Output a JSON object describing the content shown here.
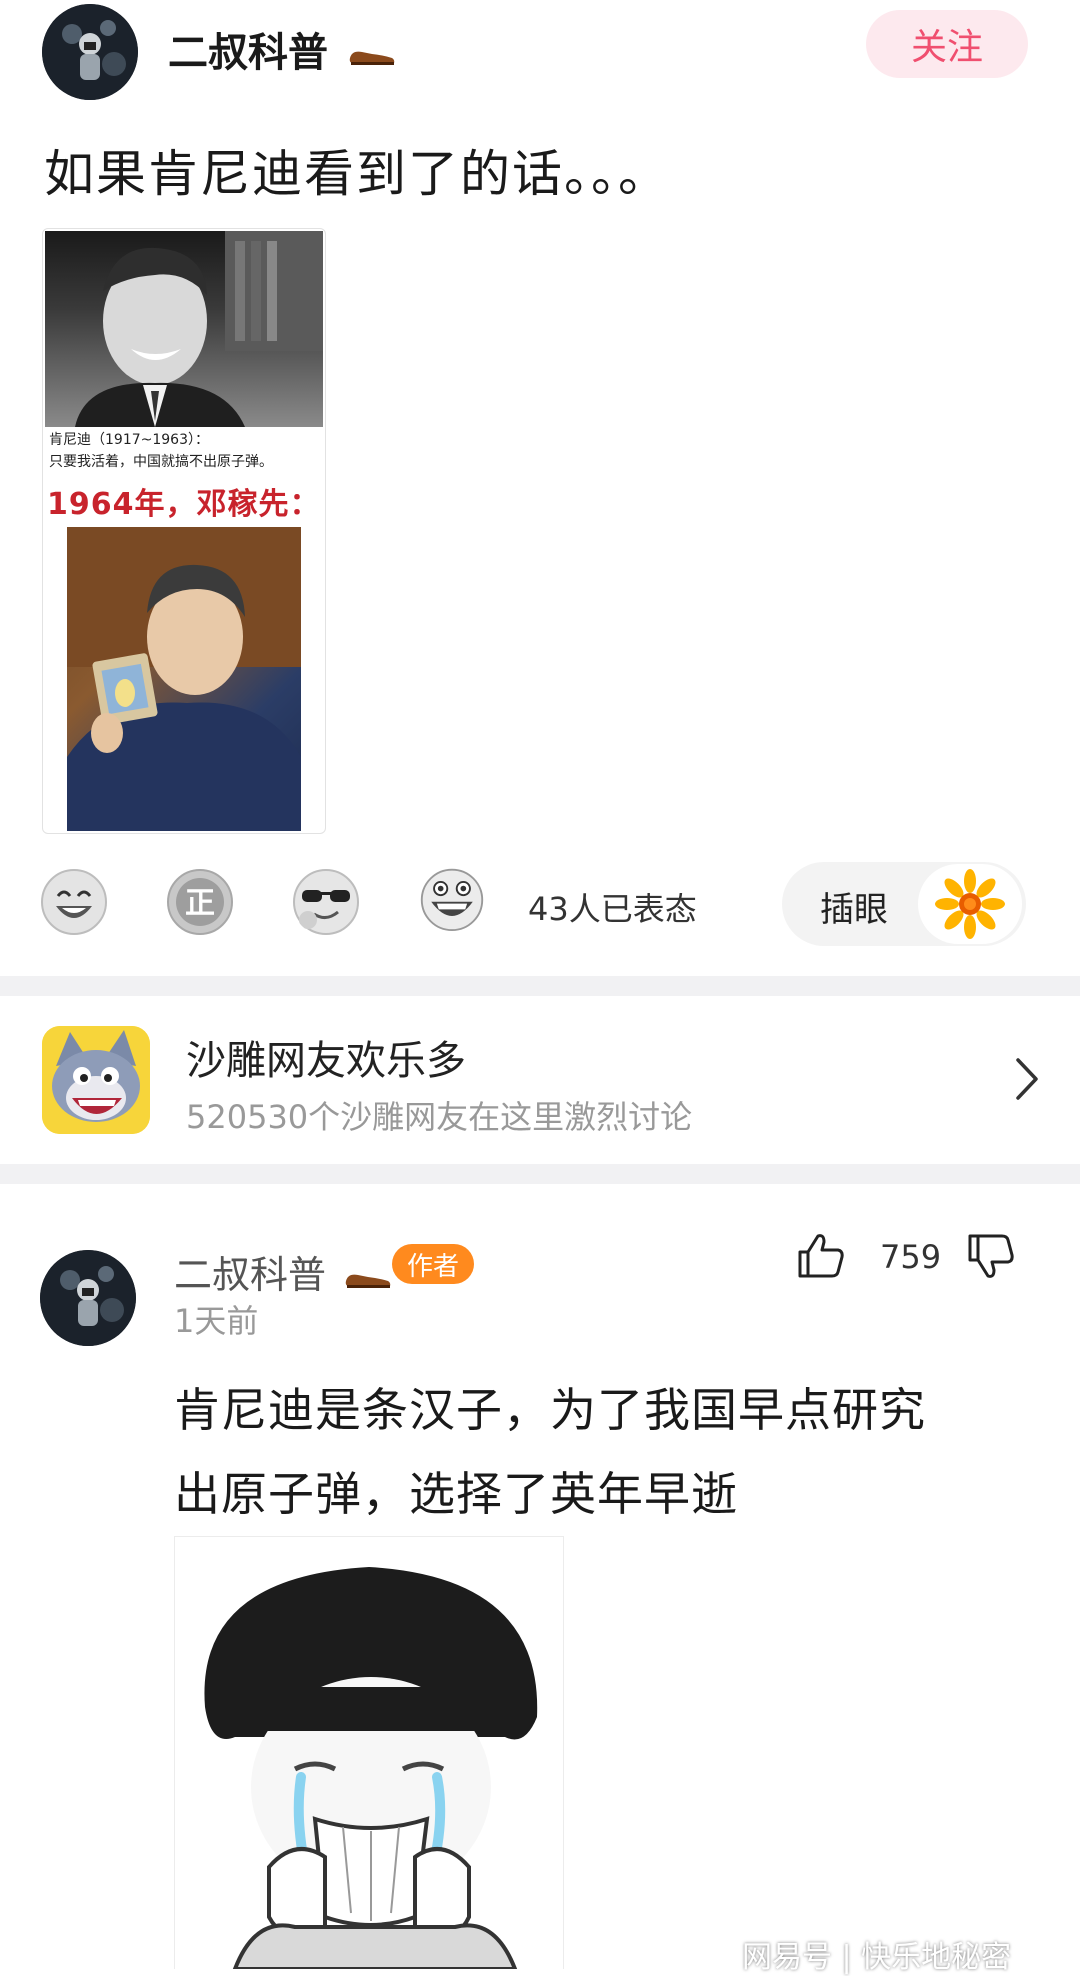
{
  "post": {
    "author": "二叔科普",
    "author_badge_icon": "shoe-icon",
    "follow_label": "关注",
    "title": "如果肯尼迪看到了的话。。。",
    "image": {
      "caption_line1": "肯尼迪（1917~1963）：",
      "caption_line2": "只要我活着，中国就搞不出原子弹。",
      "headline": "1964年，邓稼先："
    }
  },
  "reactions": {
    "icons": [
      "laughing-face-icon",
      "zheng-badge-icon",
      "sunglasses-face-icon",
      "grinning-face-icon"
    ],
    "count_label": "43人已表态",
    "pill_label": "插眼",
    "pill_icon": "sunflower-icon"
  },
  "community": {
    "name": "沙雕网友欢乐多",
    "description": "520530个沙雕网友在这里激烈讨论"
  },
  "comment": {
    "author": "二叔科普",
    "author_badge": "作者",
    "time": "1天前",
    "likes": "759",
    "text_line1": "肯尼迪是条汉子，为了我国早点研究",
    "text_line2": "出原子弹，选择了英年早逝"
  },
  "watermark": "网易号 | 快乐地秘密",
  "colors": {
    "follow_text": "#f04f6f",
    "follow_bg": "#fde9ee",
    "author_badge_bg": "#ff8a1e",
    "headline_red": "#c8232c",
    "separator": "#f1f1f3"
  }
}
